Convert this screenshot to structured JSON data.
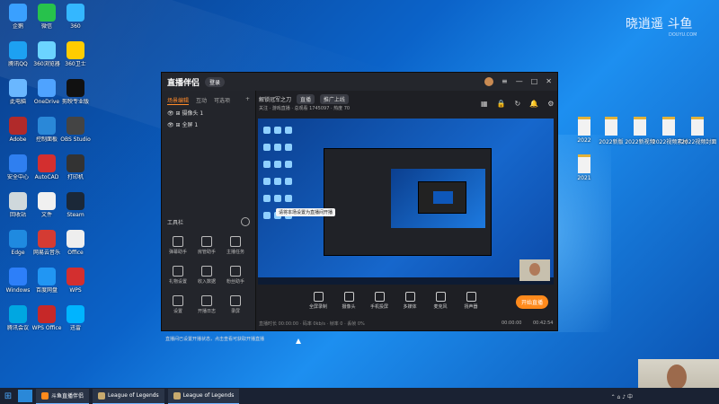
{
  "watermark": {
    "brand": "晓逍遥 斗鱼",
    "site": "DOUYU.COM"
  },
  "desktop_icons": [
    {
      "label": "企鹅",
      "color": "#3aa0ff"
    },
    {
      "label": "微信",
      "color": "#27c24c"
    },
    {
      "label": "360",
      "color": "#34b7ff"
    },
    {
      "label": "腾讯QQ",
      "color": "#1da1f2"
    },
    {
      "label": "360浏览器",
      "color": "#6bd4ff"
    },
    {
      "label": "360卫士",
      "color": "#ffcc00"
    },
    {
      "label": "此电脑",
      "color": "#6ab7ff"
    },
    {
      "label": "OneDrive",
      "color": "#4fa3ff"
    },
    {
      "label": "剪映专业版",
      "color": "#111111"
    },
    {
      "label": "Adobe",
      "color": "#b12a2a"
    },
    {
      "label": "控制面板",
      "color": "#2a88d8"
    },
    {
      "label": "OBS Studio",
      "color": "#444444"
    },
    {
      "label": "安全中心",
      "color": "#2f7ff0"
    },
    {
      "label": "AutoCAD",
      "color": "#d32f2f"
    },
    {
      "label": "打印机",
      "color": "#333333"
    },
    {
      "label": "回收站",
      "color": "#cfd8dc"
    },
    {
      "label": "文件",
      "color": "#f0f0f0"
    },
    {
      "label": "Steam",
      "color": "#1b2838"
    },
    {
      "label": "Edge",
      "color": "#1f8ae0"
    },
    {
      "label": "网易云音乐",
      "color": "#d43b33"
    },
    {
      "label": "Office",
      "color": "#eeeeee"
    },
    {
      "label": "Windows",
      "color": "#2d7ff9"
    },
    {
      "label": "百度网盘",
      "color": "#2196f3"
    },
    {
      "label": "WPS",
      "color": "#d32f2f"
    },
    {
      "label": "腾讯会议",
      "color": "#00a7e1"
    },
    {
      "label": "WPS Office",
      "color": "#c62828"
    },
    {
      "label": "迅雷",
      "color": "#00b4ff"
    }
  ],
  "desktop_files": [
    {
      "label": "2022"
    },
    {
      "label": "2022新版"
    },
    {
      "label": "2022新视频"
    },
    {
      "label": "2022视频素材"
    },
    {
      "label": "2022视频封面"
    },
    {
      "label": "2021"
    }
  ],
  "app": {
    "logo": "直播伴侣",
    "login": "登录",
    "tabs": [
      "场景编辑",
      "互动",
      "可选项"
    ],
    "scenes": [
      "摄像头 1",
      "全屏 1"
    ],
    "tools_header": "工具栏",
    "tools": [
      "弹幕助手",
      "房管助手",
      "主播任务",
      "礼物设置",
      "收入数据",
      "粉丝助手",
      "设置",
      "开播日志",
      "录屏"
    ],
    "notice": "直播间已设置开播状态，点击查看可获取开播直播",
    "room_title": "解锁冠军之刀",
    "room_chip": "直播",
    "room_btn": "推广上线",
    "info_line": "关注 · 游戏直播 · 总观看 1745097 · 热度 70",
    "bottom_tools": [
      "全屏录制",
      "摄像头",
      "手机投屏",
      "多媒体",
      "麦克风",
      "扬声器"
    ],
    "tooltip": "请将本场设置为直播间开播",
    "go_live": "开始直播",
    "status_left": "直播时长 00:00:00 · 码率 0kb/s · 帧率 0 · 丢帧 0%",
    "time1": "00:00:00",
    "time2": "00:42:54"
  },
  "taskbar": {
    "tasks": [
      "斗鱼直播伴侣",
      "League of Legends",
      "League of Legends"
    ],
    "tray": "⌃ ⌂ ♪ 中"
  }
}
